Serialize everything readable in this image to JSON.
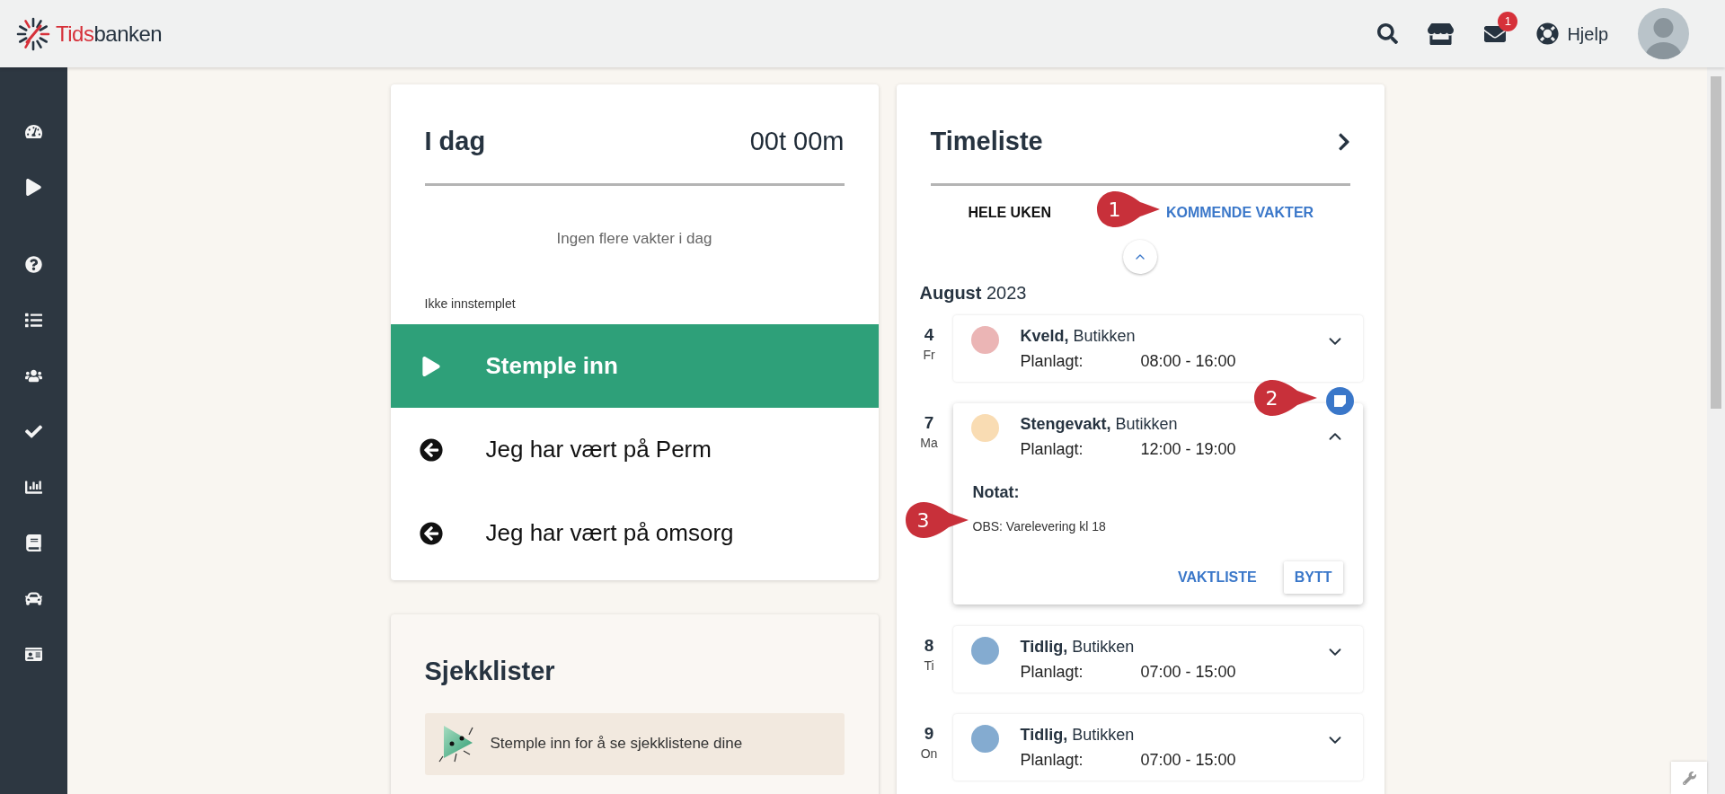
{
  "header": {
    "logo": {
      "first": "Tids",
      "second": "banken"
    },
    "mail_badge": "1",
    "help": "Hjelp"
  },
  "today": {
    "title": "I dag",
    "duration": "00t 00m",
    "empty": "Ingen flere vakter i dag",
    "status": "Ikke innstemplet",
    "actions": [
      {
        "kind": "primary",
        "label": "Stemple inn"
      },
      {
        "kind": "secondary",
        "label": "Jeg har vært på Perm"
      },
      {
        "kind": "secondary",
        "label": "Jeg har vært på omsorg"
      }
    ]
  },
  "checklists": {
    "title": "Sjekklister",
    "message": "Stemple inn for å se sjekklistene dine"
  },
  "timesheet": {
    "title": "Timeliste",
    "tabs": [
      {
        "label": "HELE UKEN",
        "selected": false
      },
      {
        "label": "KOMMENDE VAKTER",
        "selected": true
      }
    ],
    "month": "**August** 2023",
    "shifts": [
      {
        "day": "4",
        "weekday": "Fr",
        "title": "**Kveld,** Butikken",
        "label": "Planlagt:",
        "time": "08:00 - 16:00",
        "color": "#ebb5b5",
        "expanded": false,
        "note_button": false
      },
      {
        "day": "7",
        "weekday": "Ma",
        "title": "**Stengevakt,** Butikken",
        "label": "Planlagt:",
        "time": "12:00 - 19:00",
        "color": "#f9dcb3",
        "expanded": true,
        "note_button": true,
        "note_label": "Notat:",
        "note": "OBS: Varelevering kl 18",
        "buttons": [
          {
            "kind": "flat",
            "label": "VAKTLISTE"
          },
          {
            "kind": "raised",
            "label": "BYTT"
          }
        ]
      },
      {
        "day": "8",
        "weekday": "Ti",
        "title": "**Tidlig,** Butikken",
        "label": "Planlagt:",
        "time": "07:00 - 15:00",
        "color": "#84abd0",
        "expanded": false,
        "note_button": false
      },
      {
        "day": "9",
        "weekday": "On",
        "title": "**Tidlig,** Butikken",
        "label": "Planlagt:",
        "time": "07:00 - 15:00",
        "color": "#84abd0",
        "expanded": false,
        "note_button": false
      }
    ]
  },
  "callouts": [
    "1",
    "2",
    "3"
  ]
}
